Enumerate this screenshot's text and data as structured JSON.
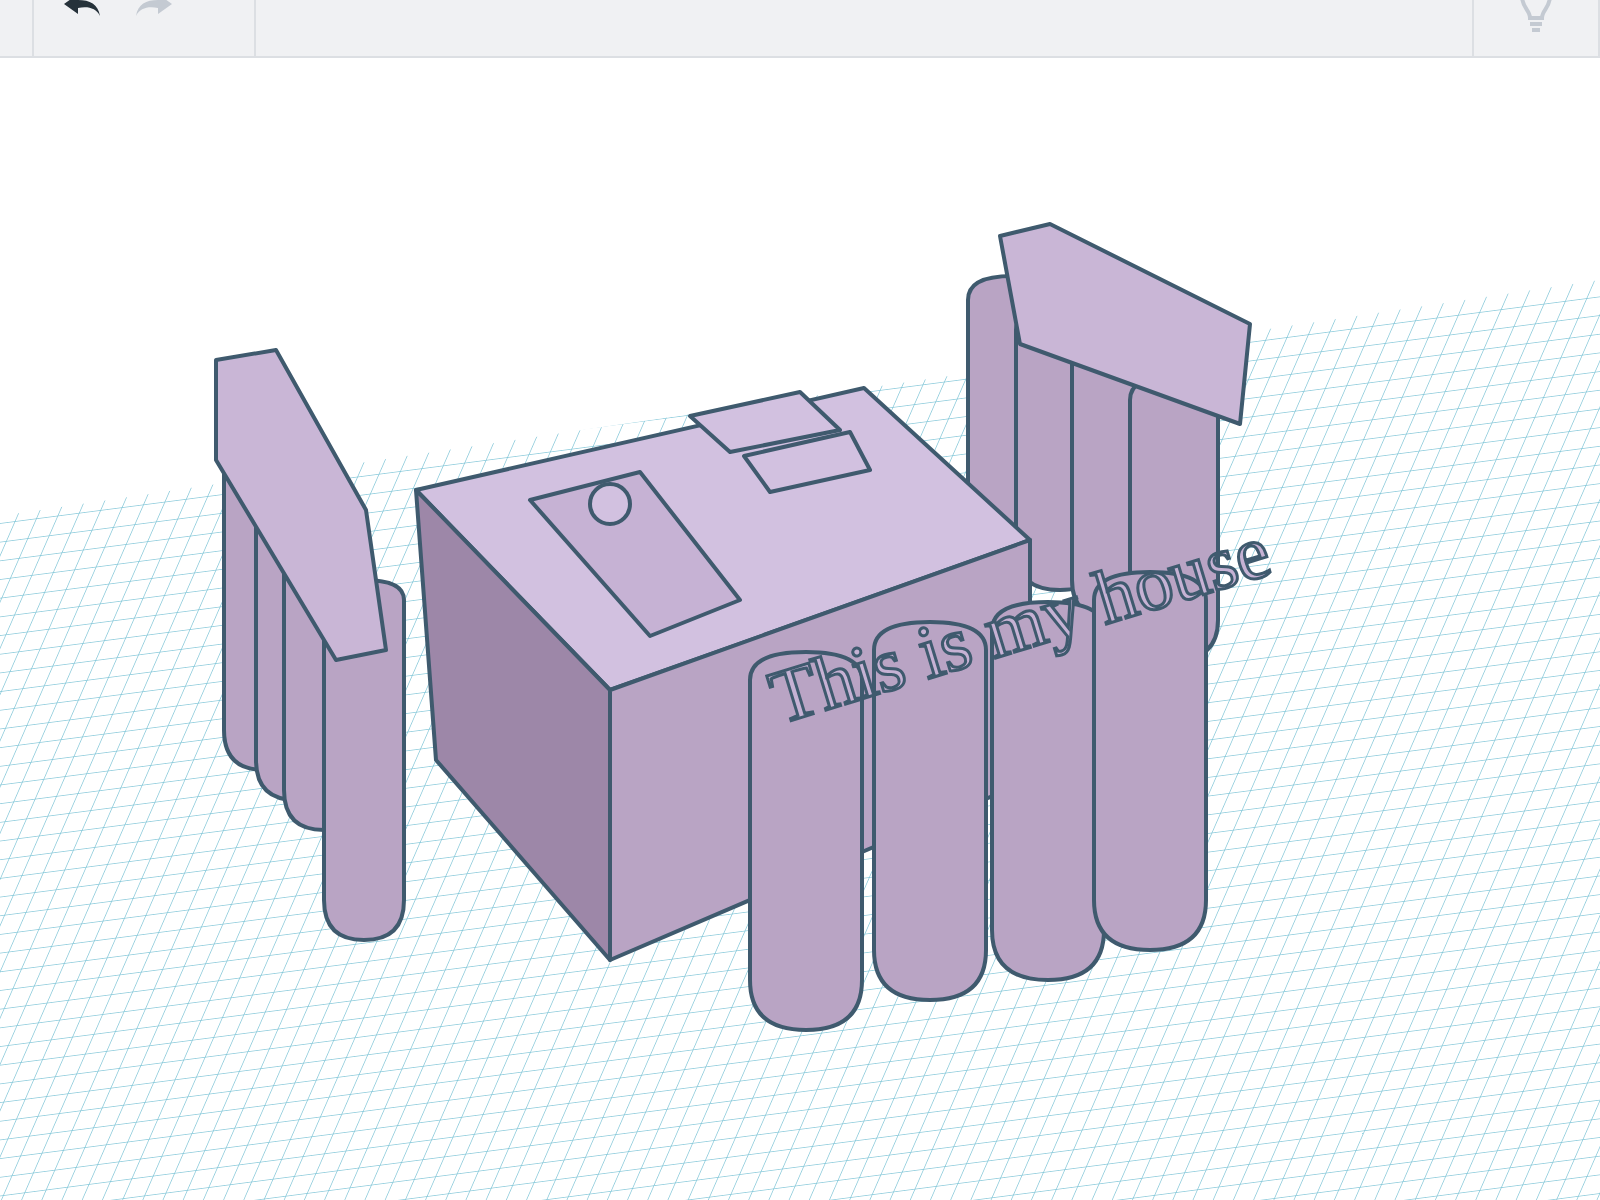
{
  "toolbar": {
    "undo": {
      "disabled": false
    },
    "redo": {
      "disabled": true
    }
  },
  "scene": {
    "model_text": "This is my house"
  }
}
